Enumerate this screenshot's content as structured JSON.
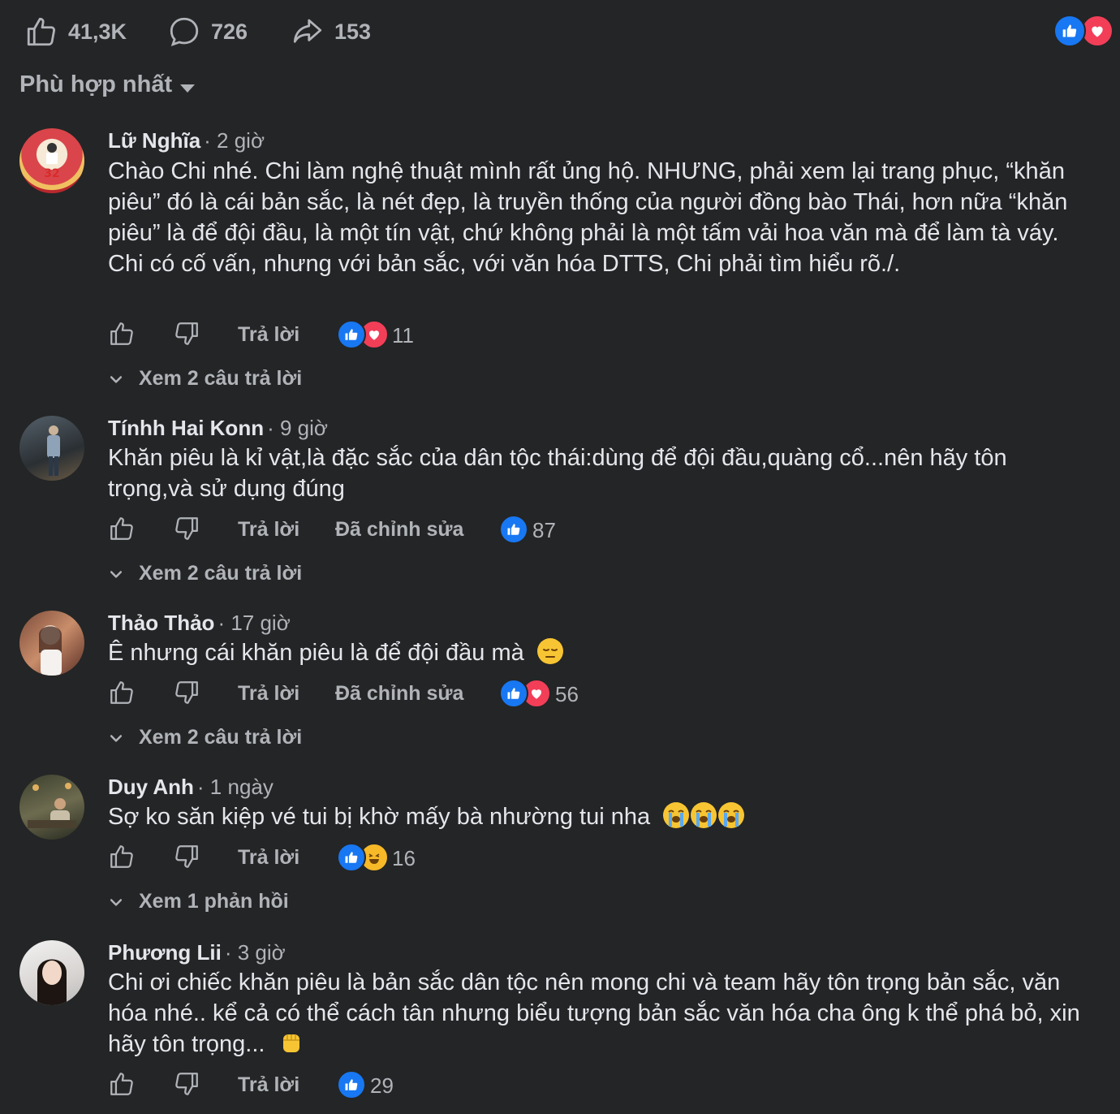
{
  "stats": {
    "likes": "41,3K",
    "comments": "726",
    "shares": "153"
  },
  "sort": {
    "label": "Phù hợp nhất"
  },
  "actions": {
    "reply": "Trả lời",
    "edited": "Đã chỉnh sửa"
  },
  "colors": {
    "background": "#242526",
    "text": "#e4e6eb",
    "muted": "#b0b3b8",
    "like": "#1877f2",
    "love": "#f33e58"
  },
  "comments": [
    {
      "author": "Lữ Nghĩa",
      "time": "· 2 giờ",
      "text": "Chào Chi nhé. Chi làm nghệ thuật mình rất ủng hộ. NHƯNG, phải xem lại trang phục, “khăn piêu” đó là cái bản sắc, là nét đẹp, là truyền thống của người đồng bào Thái, hơn nữa “khăn piêu” là để đội đầu, là một tín vật, chứ không phải là một tấm vải hoa văn mà để làm tà váy. Chi có cố vấn, nhưng với bản sắc, với văn hóa DTTS, Chi phải tìm hiểu rõ./.",
      "reactions": [
        "like-icon",
        "love-icon"
      ],
      "reaction_count": "11",
      "replies": "Xem 2 câu trả lời"
    },
    {
      "author": "Tínhh Hai Konn",
      "time": "· 9 giờ",
      "text": "Khăn piêu là kỉ vật,là đặc sắc của dân tộc thái:dùng để đội đầu,quàng cổ...nên hãy tôn trọng,và sử dụng đúng",
      "reactions": [
        "like-icon"
      ],
      "reaction_count": "87",
      "replies": "Xem 2 câu trả lời"
    },
    {
      "author": "Thảo Thảo",
      "time": "· 17 giờ",
      "text": "Ê nhưng cái khăn piêu là để đội đầu mà",
      "emoji": "pensive-face-emoji",
      "reactions": [
        "like-icon",
        "love-icon"
      ],
      "reaction_count": "56",
      "replies": "Xem 2 câu trả lời"
    },
    {
      "author": "Duy Anh",
      "time": "· 1 ngày",
      "text": "Sợ ko săn kiệp vé tui bị khờ mấy bà nhường tui nha",
      "emoji": "loudly-crying-face-emoji ×3",
      "reactions": [
        "like-icon",
        "haha-icon"
      ],
      "reaction_count": "16",
      "replies": "Xem 1 phản hồi"
    },
    {
      "author": "Phương Lii",
      "time": "· 3 giờ",
      "text": "Chi ơi chiếc khăn piêu là bản sắc dân tộc nên mong chi và team hãy tôn trọng bản sắc, văn hóa nhé.. kể cả có thể cách tân nhưng biểu tượng bản sắc văn hóa cha ông k thể phá bỏ, xin hãy tôn trọng...",
      "emoji": "raised-fist-emoji",
      "reactions": [
        "like-icon"
      ],
      "reaction_count": "29"
    }
  ]
}
